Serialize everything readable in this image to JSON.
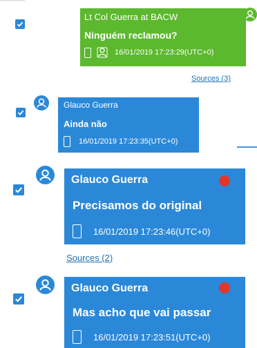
{
  "colors": {
    "outgoing_bubble": "#5cb82e",
    "incoming_bubble": "#2b88d8",
    "checkbox": "#2b88d8",
    "link": "#1f6fb2",
    "status_dot": "#e0362c"
  },
  "messages": [
    {
      "direction": "outgoing",
      "sender": "Lt Col Guerra at BACW",
      "text": "Ninguém reclamou?",
      "timestamp": "16/01/2019 17:23:29(UTC+0)",
      "icons": [
        "phone-icon",
        "group-icon"
      ],
      "checked": true,
      "sources": "Sources (3)"
    },
    {
      "direction": "incoming",
      "sender": "Glauco Guerra",
      "text": "Ainda não",
      "timestamp": "16/01/2019 17:23:35(UTC+0)",
      "icons": [
        "phone-icon"
      ],
      "checked": true
    },
    {
      "direction": "incoming",
      "sender": "Glauco Guerra",
      "text": "Precisamos do original",
      "timestamp": "16/01/2019 17:23:46(UTC+0)",
      "icons": [
        "phone-icon"
      ],
      "status_dot": true,
      "checked": true,
      "sources": "Sources (2)"
    },
    {
      "direction": "incoming",
      "sender": "Glauco Guerra",
      "text": "Mas acho que vai passar",
      "timestamp": "16/01/2019 17:23:51(UTC+0)",
      "icons": [
        "phone-icon"
      ],
      "status_dot": true,
      "checked": true
    }
  ]
}
